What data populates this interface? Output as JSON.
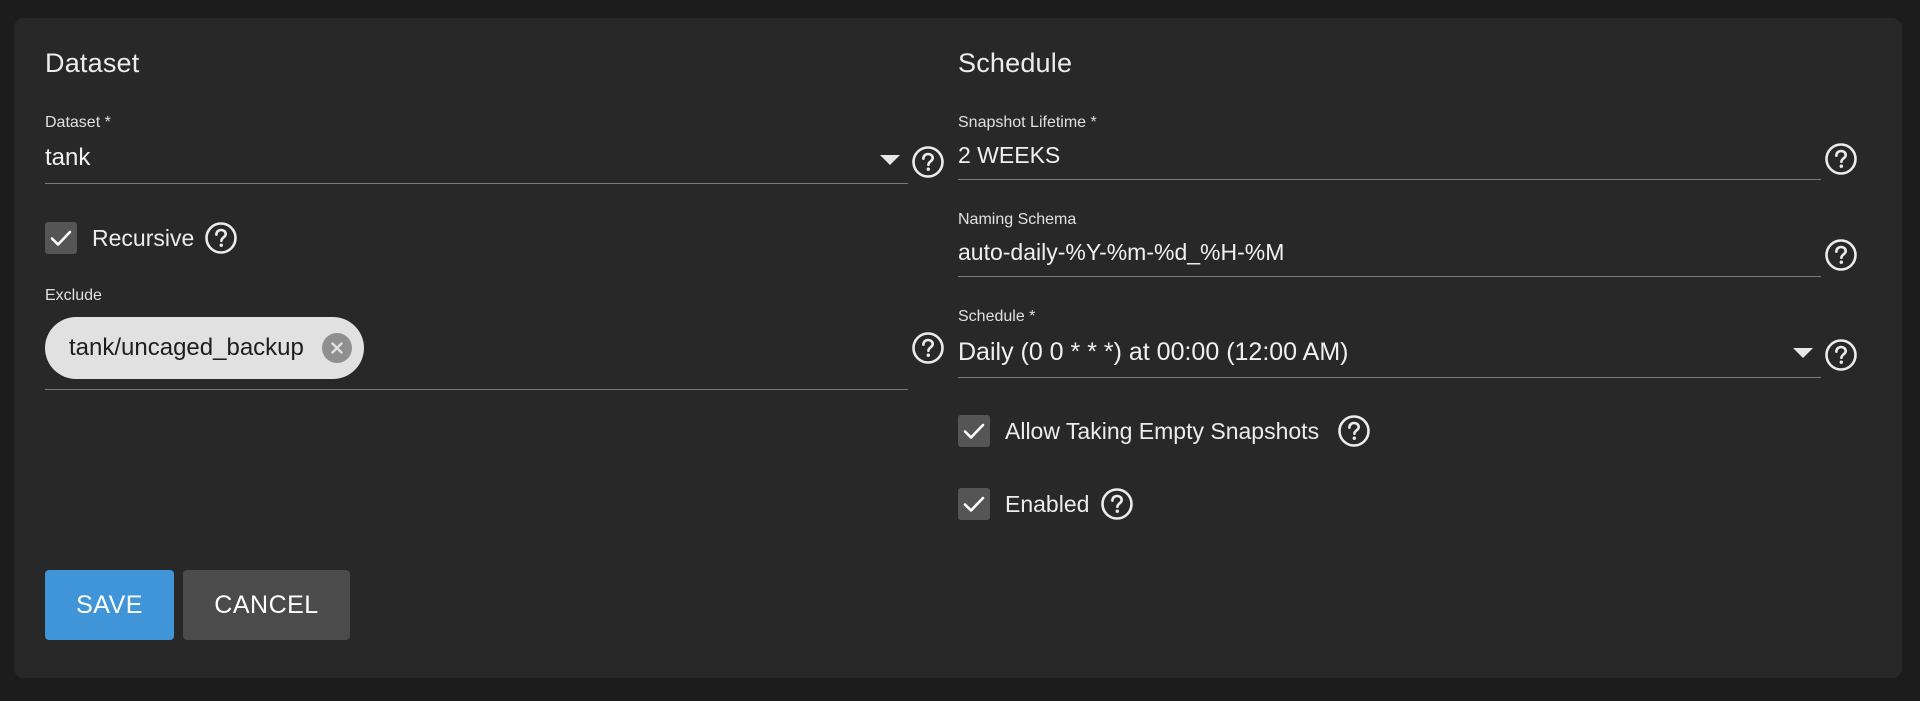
{
  "dataset_section": {
    "title": "Dataset",
    "dataset_field": {
      "label": "Dataset *",
      "value": "tank"
    },
    "recursive": {
      "label": "Recursive",
      "checked": true
    },
    "exclude": {
      "label": "Exclude",
      "chips": [
        "tank/uncaged_backup"
      ]
    }
  },
  "schedule_section": {
    "title": "Schedule",
    "lifetime": {
      "label": "Snapshot Lifetime *",
      "value": "2 WEEKS"
    },
    "naming_schema": {
      "label": "Naming Schema",
      "value": "auto-daily-%Y-%m-%d_%H-%M"
    },
    "schedule": {
      "label": "Schedule *",
      "value": "Daily (0 0 * * *) at 00:00 (12:00 AM)"
    },
    "allow_empty": {
      "label": "Allow Taking Empty Snapshots",
      "checked": true
    },
    "enabled": {
      "label": "Enabled",
      "checked": true
    }
  },
  "actions": {
    "save_label": "SAVE",
    "cancel_label": "CANCEL"
  },
  "colors": {
    "background": "#1c1c1c",
    "card": "#282828",
    "primary": "#3f95d8",
    "secondary": "#4b4b4b",
    "chip": "#e1e1e1"
  },
  "icons": {
    "help": "help-circle-icon",
    "dropdown": "caret-down-icon",
    "check": "check-icon",
    "chip_remove": "cancel-circle-icon"
  }
}
